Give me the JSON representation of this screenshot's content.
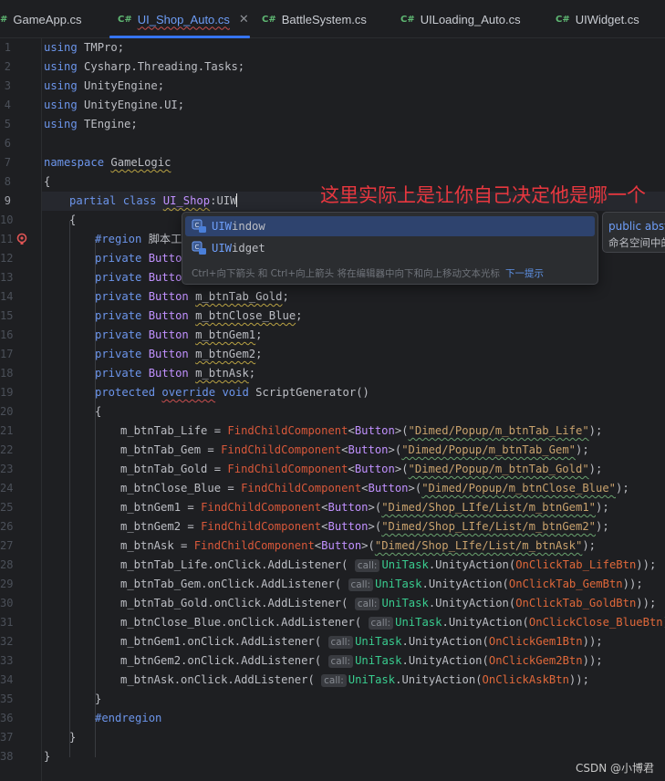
{
  "tabs": [
    {
      "label": "GameApp.cs",
      "icon": "#",
      "active": false
    },
    {
      "label": "UI_Shop_Auto.cs",
      "icon": "C#",
      "active": true,
      "close": "✕"
    },
    {
      "label": "BattleSystem.cs",
      "icon": "C#",
      "active": false
    },
    {
      "label": "UILoading_Auto.cs",
      "icon": "C#",
      "active": false
    },
    {
      "label": "UIWidget.cs",
      "icon": "C#",
      "active": false
    }
  ],
  "line_numbers": [
    "1",
    "2",
    "3",
    "4",
    "5",
    "6",
    "7",
    "8",
    "9",
    "10",
    "11",
    "12",
    "13",
    "14",
    "15",
    "16",
    "17",
    "18",
    "19",
    "20",
    "21",
    "22",
    "23",
    "24",
    "25",
    "26",
    "27",
    "28",
    "29",
    "30",
    "31",
    "32",
    "33",
    "34",
    "35",
    "36",
    "37",
    "38"
  ],
  "current_line": "9",
  "code": {
    "using": "using",
    "ns1": " TMPro;",
    "ns2": " Cysharp.Threading.Tasks;",
    "ns3": " UnityEngine;",
    "ns4": " UnityEngine.UI;",
    "ns5": " TEngine;",
    "namespace_kw": "namespace",
    "namespace_name": "GameLogic",
    "brace_open": "{",
    "brace_close": "}",
    "partial": "partial",
    "class": "class",
    "class_name": "UI_Shop",
    "typed": ":UIW",
    "region": "#region",
    "region_name": " 脚本工",
    "private": "private",
    "button": "Button",
    "f_tab_gold": "m_btnTab_Gold",
    "f_close_blue": "m_btnClose_Blue",
    "f_gem1": "m_btnGem1",
    "f_gem2": "m_btnGem2",
    "f_ask": "m_btnAsk",
    "semi": ";",
    "protected": "protected",
    "override": "override",
    "void": "void",
    "method_name": "ScriptGenerator",
    "parens": "()",
    "assign_lines": [
      {
        "field": "m_btnTab_Life",
        "path": "\"Dimed/Popup/m_btnTab_Life\""
      },
      {
        "field": "m_btnTab_Gem",
        "path": "\"Dimed/Popup/m_btnTab_Gem\""
      },
      {
        "field": "m_btnTab_Gold",
        "path": "\"Dimed/Popup/m_btnTab_Gold\""
      },
      {
        "field": "m_btnClose_Blue",
        "path": "\"Dimed/Popup/m_btnClose_Blue\""
      },
      {
        "field": "m_btnGem1",
        "path": "\"Dimed/Shop_LIfe/List/m_btnGem1\""
      },
      {
        "field": "m_btnGem2",
        "path": "\"Dimed/Shop_LIfe/List/m_btnGem2\""
      },
      {
        "field": "m_btnAsk",
        "path": "\"Dimed/Shop_LIfe/List/m_btnAsk\""
      }
    ],
    "find_child": "FindChildComponent",
    "listen_lines": [
      {
        "field": "m_btnTab_Life",
        "handler": "OnClickTab_LifeBtn"
      },
      {
        "field": "m_btnTab_Gem",
        "handler": "OnClickTab_GemBtn"
      },
      {
        "field": "m_btnTab_Gold",
        "handler": "OnClickTab_GoldBtn"
      },
      {
        "field": "m_btnClose_Blue",
        "handler": "OnClickClose_BlueBtn"
      },
      {
        "field": "m_btnGem1",
        "handler": "OnClickGem1Btn"
      },
      {
        "field": "m_btnGem2",
        "handler": "OnClickGem2Btn"
      },
      {
        "field": "m_btnAsk",
        "handler": "OnClickAskBtn"
      }
    ],
    "on_click": ".onClick.",
    "add_listener": "AddListener",
    "call_hint": "call:",
    "unitask": "UniTask",
    "unity_action": "UnityAction",
    "endregion": "#endregion"
  },
  "completion": {
    "items": [
      {
        "match": "UIW",
        "rest": "indow"
      },
      {
        "match": "UIW",
        "rest": "idget"
      }
    ],
    "footer": "Ctrl+向下箭头 和 Ctrl+向上箭头 将在编辑器中向下和向上移动文本光标",
    "footer_link": "下一提示"
  },
  "doc_popup": {
    "line1": "public abst",
    "line2": "命名空间中的"
  },
  "annotation": "这里实际上是让你自己决定他是哪一个",
  "watermark": "CSDN @小博君",
  "colors": {
    "keyword": "#6c95eb",
    "type": "#c191ff",
    "field": "#66c3cc",
    "string": "#c9a26d",
    "method_ref": "#d9583a",
    "selection": "#2e436e",
    "annotation": "#e8373f"
  }
}
